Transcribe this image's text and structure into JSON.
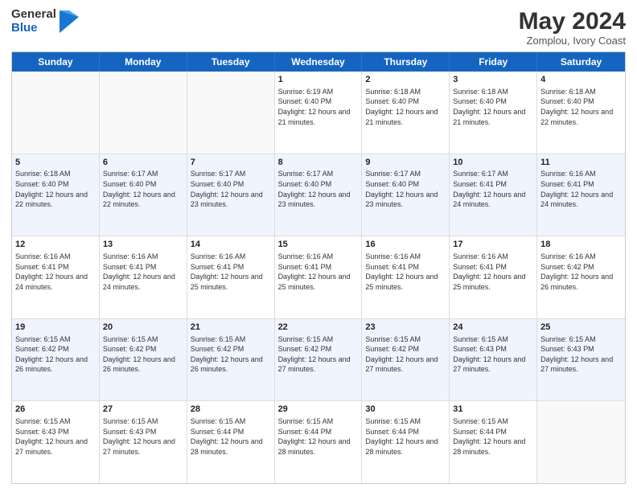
{
  "logo": {
    "general": "General",
    "blue": "Blue"
  },
  "title": "May 2024",
  "subtitle": "Zomplou, Ivory Coast",
  "days": [
    "Sunday",
    "Monday",
    "Tuesday",
    "Wednesday",
    "Thursday",
    "Friday",
    "Saturday"
  ],
  "rows": [
    [
      {
        "day": "",
        "sunrise": "",
        "sunset": "",
        "daylight": "",
        "empty": true
      },
      {
        "day": "",
        "sunrise": "",
        "sunset": "",
        "daylight": "",
        "empty": true
      },
      {
        "day": "",
        "sunrise": "",
        "sunset": "",
        "daylight": "",
        "empty": true
      },
      {
        "day": "1",
        "sunrise": "Sunrise: 6:19 AM",
        "sunset": "Sunset: 6:40 PM",
        "daylight": "Daylight: 12 hours and 21 minutes.",
        "empty": false
      },
      {
        "day": "2",
        "sunrise": "Sunrise: 6:18 AM",
        "sunset": "Sunset: 6:40 PM",
        "daylight": "Daylight: 12 hours and 21 minutes.",
        "empty": false
      },
      {
        "day": "3",
        "sunrise": "Sunrise: 6:18 AM",
        "sunset": "Sunset: 6:40 PM",
        "daylight": "Daylight: 12 hours and 21 minutes.",
        "empty": false
      },
      {
        "day": "4",
        "sunrise": "Sunrise: 6:18 AM",
        "sunset": "Sunset: 6:40 PM",
        "daylight": "Daylight: 12 hours and 22 minutes.",
        "empty": false
      }
    ],
    [
      {
        "day": "5",
        "sunrise": "Sunrise: 6:18 AM",
        "sunset": "Sunset: 6:40 PM",
        "daylight": "Daylight: 12 hours and 22 minutes.",
        "empty": false
      },
      {
        "day": "6",
        "sunrise": "Sunrise: 6:17 AM",
        "sunset": "Sunset: 6:40 PM",
        "daylight": "Daylight: 12 hours and 22 minutes.",
        "empty": false
      },
      {
        "day": "7",
        "sunrise": "Sunrise: 6:17 AM",
        "sunset": "Sunset: 6:40 PM",
        "daylight": "Daylight: 12 hours and 23 minutes.",
        "empty": false
      },
      {
        "day": "8",
        "sunrise": "Sunrise: 6:17 AM",
        "sunset": "Sunset: 6:40 PM",
        "daylight": "Daylight: 12 hours and 23 minutes.",
        "empty": false
      },
      {
        "day": "9",
        "sunrise": "Sunrise: 6:17 AM",
        "sunset": "Sunset: 6:40 PM",
        "daylight": "Daylight: 12 hours and 23 minutes.",
        "empty": false
      },
      {
        "day": "10",
        "sunrise": "Sunrise: 6:17 AM",
        "sunset": "Sunset: 6:41 PM",
        "daylight": "Daylight: 12 hours and 24 minutes.",
        "empty": false
      },
      {
        "day": "11",
        "sunrise": "Sunrise: 6:16 AM",
        "sunset": "Sunset: 6:41 PM",
        "daylight": "Daylight: 12 hours and 24 minutes.",
        "empty": false
      }
    ],
    [
      {
        "day": "12",
        "sunrise": "Sunrise: 6:16 AM",
        "sunset": "Sunset: 6:41 PM",
        "daylight": "Daylight: 12 hours and 24 minutes.",
        "empty": false
      },
      {
        "day": "13",
        "sunrise": "Sunrise: 6:16 AM",
        "sunset": "Sunset: 6:41 PM",
        "daylight": "Daylight: 12 hours and 24 minutes.",
        "empty": false
      },
      {
        "day": "14",
        "sunrise": "Sunrise: 6:16 AM",
        "sunset": "Sunset: 6:41 PM",
        "daylight": "Daylight: 12 hours and 25 minutes.",
        "empty": false
      },
      {
        "day": "15",
        "sunrise": "Sunrise: 6:16 AM",
        "sunset": "Sunset: 6:41 PM",
        "daylight": "Daylight: 12 hours and 25 minutes.",
        "empty": false
      },
      {
        "day": "16",
        "sunrise": "Sunrise: 6:16 AM",
        "sunset": "Sunset: 6:41 PM",
        "daylight": "Daylight: 12 hours and 25 minutes.",
        "empty": false
      },
      {
        "day": "17",
        "sunrise": "Sunrise: 6:16 AM",
        "sunset": "Sunset: 6:41 PM",
        "daylight": "Daylight: 12 hours and 25 minutes.",
        "empty": false
      },
      {
        "day": "18",
        "sunrise": "Sunrise: 6:16 AM",
        "sunset": "Sunset: 6:42 PM",
        "daylight": "Daylight: 12 hours and 26 minutes.",
        "empty": false
      }
    ],
    [
      {
        "day": "19",
        "sunrise": "Sunrise: 6:15 AM",
        "sunset": "Sunset: 6:42 PM",
        "daylight": "Daylight: 12 hours and 26 minutes.",
        "empty": false
      },
      {
        "day": "20",
        "sunrise": "Sunrise: 6:15 AM",
        "sunset": "Sunset: 6:42 PM",
        "daylight": "Daylight: 12 hours and 26 minutes.",
        "empty": false
      },
      {
        "day": "21",
        "sunrise": "Sunrise: 6:15 AM",
        "sunset": "Sunset: 6:42 PM",
        "daylight": "Daylight: 12 hours and 26 minutes.",
        "empty": false
      },
      {
        "day": "22",
        "sunrise": "Sunrise: 6:15 AM",
        "sunset": "Sunset: 6:42 PM",
        "daylight": "Daylight: 12 hours and 27 minutes.",
        "empty": false
      },
      {
        "day": "23",
        "sunrise": "Sunrise: 6:15 AM",
        "sunset": "Sunset: 6:42 PM",
        "daylight": "Daylight: 12 hours and 27 minutes.",
        "empty": false
      },
      {
        "day": "24",
        "sunrise": "Sunrise: 6:15 AM",
        "sunset": "Sunset: 6:43 PM",
        "daylight": "Daylight: 12 hours and 27 minutes.",
        "empty": false
      },
      {
        "day": "25",
        "sunrise": "Sunrise: 6:15 AM",
        "sunset": "Sunset: 6:43 PM",
        "daylight": "Daylight: 12 hours and 27 minutes.",
        "empty": false
      }
    ],
    [
      {
        "day": "26",
        "sunrise": "Sunrise: 6:15 AM",
        "sunset": "Sunset: 6:43 PM",
        "daylight": "Daylight: 12 hours and 27 minutes.",
        "empty": false
      },
      {
        "day": "27",
        "sunrise": "Sunrise: 6:15 AM",
        "sunset": "Sunset: 6:43 PM",
        "daylight": "Daylight: 12 hours and 27 minutes.",
        "empty": false
      },
      {
        "day": "28",
        "sunrise": "Sunrise: 6:15 AM",
        "sunset": "Sunset: 6:44 PM",
        "daylight": "Daylight: 12 hours and 28 minutes.",
        "empty": false
      },
      {
        "day": "29",
        "sunrise": "Sunrise: 6:15 AM",
        "sunset": "Sunset: 6:44 PM",
        "daylight": "Daylight: 12 hours and 28 minutes.",
        "empty": false
      },
      {
        "day": "30",
        "sunrise": "Sunrise: 6:15 AM",
        "sunset": "Sunset: 6:44 PM",
        "daylight": "Daylight: 12 hours and 28 minutes.",
        "empty": false
      },
      {
        "day": "31",
        "sunrise": "Sunrise: 6:15 AM",
        "sunset": "Sunset: 6:44 PM",
        "daylight": "Daylight: 12 hours and 28 minutes.",
        "empty": false
      },
      {
        "day": "",
        "sunrise": "",
        "sunset": "",
        "daylight": "",
        "empty": true
      }
    ]
  ]
}
